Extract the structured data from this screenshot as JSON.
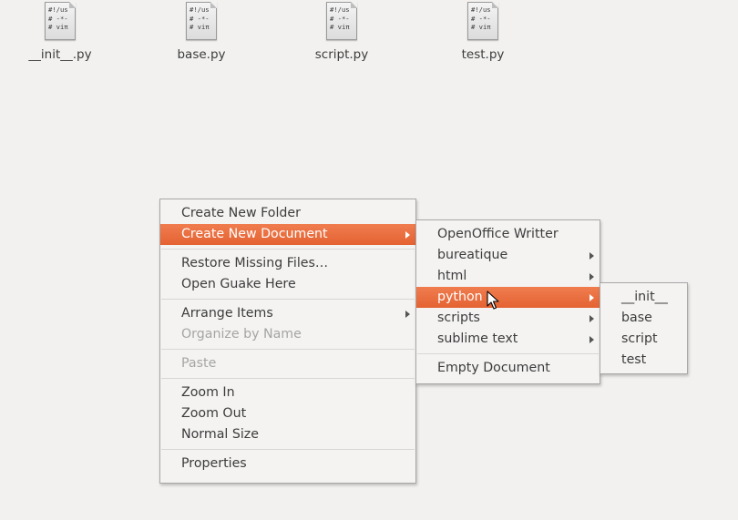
{
  "desktop": {
    "files": [
      {
        "name": "__init__.py",
        "preview": [
          "#!/us",
          "# -*-",
          "# viπ"
        ],
        "icon": "python-script-icon"
      },
      {
        "name": "base.py",
        "preview": [
          "#!/us",
          "# -*-",
          "# viπ"
        ],
        "icon": "python-script-icon"
      },
      {
        "name": "script.py",
        "preview": [
          "#!/us",
          "# -*-",
          "# viπ"
        ],
        "icon": "python-script-icon"
      },
      {
        "name": "test.py",
        "preview": [
          "#!/us",
          "# -*-",
          "# viπ"
        ],
        "icon": "python-script-icon"
      }
    ]
  },
  "context_menu": {
    "items": [
      {
        "label": "Create New Folder"
      },
      {
        "label": "Create New Document"
      },
      {
        "label": "Restore Missing Files…"
      },
      {
        "label": "Open Guake Here"
      },
      {
        "label": "Arrange Items"
      },
      {
        "label": "Organize by Name"
      },
      {
        "label": "Paste"
      },
      {
        "label": "Zoom In"
      },
      {
        "label": "Zoom Out"
      },
      {
        "label": "Normal Size"
      },
      {
        "label": "Properties"
      }
    ]
  },
  "new_document_menu": {
    "items": [
      {
        "label": "OpenOffice Writter"
      },
      {
        "label": "bureatique"
      },
      {
        "label": "html"
      },
      {
        "label": "python"
      },
      {
        "label": "scripts"
      },
      {
        "label": "sublime text"
      },
      {
        "label": "Empty Document"
      }
    ]
  },
  "python_menu": {
    "items": [
      {
        "label": "__init__"
      },
      {
        "label": "base"
      },
      {
        "label": "script"
      },
      {
        "label": "test"
      }
    ]
  },
  "colors": {
    "highlight": "#e9693b",
    "menu_bg": "#f4f3f2",
    "desktop_bg": "#f2f1f0",
    "disabled_text": "#a5a5a5"
  }
}
